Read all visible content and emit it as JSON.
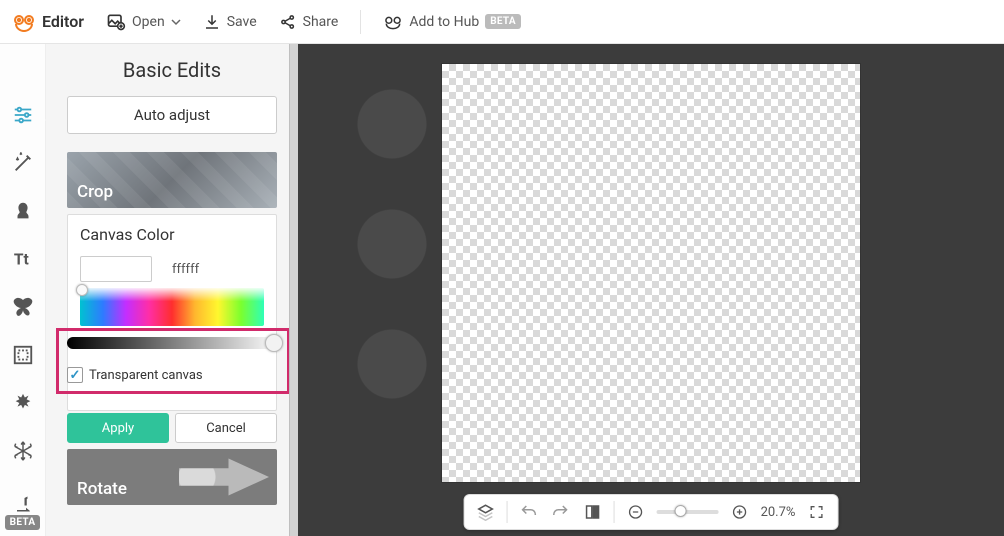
{
  "topbar": {
    "brand": "Editor",
    "open": "Open",
    "save": "Save",
    "share": "Share",
    "add_hub": "Add to Hub",
    "beta": "BETA"
  },
  "panel": {
    "title": "Basic Edits",
    "auto_adjust": "Auto adjust",
    "crop": "Crop",
    "rotate": "Rotate",
    "canvas_color": {
      "title": "Canvas Color",
      "hex": "ffffff",
      "transparent_label": "Transparent canvas",
      "transparent_checked": true,
      "apply": "Apply",
      "cancel": "Cancel"
    }
  },
  "iconstrip": {
    "beta": "BETA"
  },
  "bottombar": {
    "zoom": "20.7%"
  }
}
